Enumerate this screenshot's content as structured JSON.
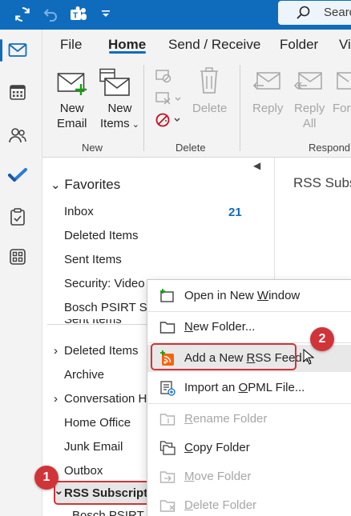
{
  "titlebar": {
    "search_placeholder": "Search",
    "color": "#0f6cbd"
  },
  "rail": {
    "items": [
      {
        "name": "mail",
        "icon": "mail-icon",
        "active": true
      },
      {
        "name": "calendar",
        "icon": "calendar-icon"
      },
      {
        "name": "people",
        "icon": "people-icon"
      },
      {
        "name": "todo",
        "icon": "checkmark-icon"
      },
      {
        "name": "tasks",
        "icon": "clipboard-icon"
      },
      {
        "name": "apps",
        "icon": "apps-icon"
      }
    ]
  },
  "ribbon": {
    "tabs": [
      "File",
      "Home",
      "Send / Receive",
      "Folder",
      "Vi"
    ],
    "active_tab": "Home",
    "new_email": {
      "line1": "New",
      "line2": "Email"
    },
    "new_items": {
      "line1": "New",
      "line2": "Items"
    },
    "delete": "Delete",
    "reply": "Reply",
    "reply_all": {
      "line1": "Reply",
      "line2": "All"
    },
    "forward": "Forw",
    "groups": {
      "new": "New",
      "delete": "Delete",
      "respond": "Respond"
    }
  },
  "folders": {
    "favorites_label": "Favorites",
    "favorites": [
      {
        "label": "Inbox",
        "count": "21"
      },
      {
        "label": "Deleted Items"
      },
      {
        "label": "Sent Items"
      },
      {
        "label": "Security: Video"
      },
      {
        "label": "Bosch PSIRT Sec"
      }
    ],
    "partial_label": "Sent Items",
    "tree": [
      {
        "label": "Deleted Items",
        "chevron": "›"
      },
      {
        "label": "Archive"
      },
      {
        "label": "Conversation Hi",
        "chevron": "›"
      },
      {
        "label": "Home Office"
      },
      {
        "label": "Junk Email"
      },
      {
        "label": "Outbox"
      },
      {
        "label": "RSS Subscriptio",
        "chevron": "⌄",
        "selected": true
      }
    ],
    "partial_bottom": "Bosch PSIRT S"
  },
  "reading": {
    "title": "RSS Subsc"
  },
  "context_menu": {
    "items": [
      {
        "label": "Open in New Window",
        "mnemonic": "W",
        "icon": "open-window-icon",
        "enabled": true
      },
      {
        "label": "New Folder...",
        "mnemonic": "N",
        "icon": "folder-icon",
        "enabled": true
      },
      {
        "label": "Add a New RSS Feed...",
        "mnemonic": "R",
        "icon": "rss-feed-icon",
        "enabled": true,
        "highlighted": true
      },
      {
        "label": "Import an OPML File...",
        "mnemonic": "O",
        "icon": "import-opml-icon",
        "enabled": true
      },
      {
        "label": "Rename Folder",
        "mnemonic": "R",
        "icon": "rename-folder-icon",
        "enabled": false
      },
      {
        "label": "Copy Folder",
        "mnemonic": "C",
        "icon": "copy-folder-icon",
        "enabled": true
      },
      {
        "label": "Move Folder",
        "mnemonic": "M",
        "icon": "move-folder-icon",
        "enabled": false
      },
      {
        "label": "Delete Folder",
        "mnemonic": "D",
        "icon": "delete-folder-icon",
        "enabled": false
      }
    ]
  },
  "badges": {
    "step1": "1",
    "step2": "2",
    "color": "#d13438"
  }
}
